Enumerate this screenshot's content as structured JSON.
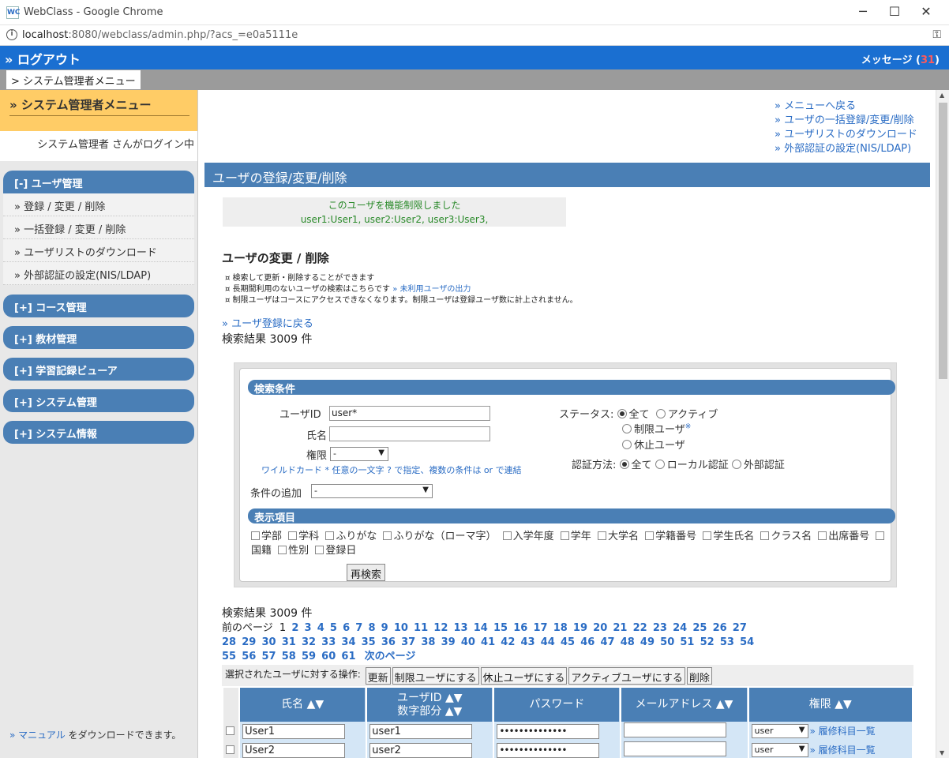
{
  "window": {
    "title": "WebClass - Google Chrome",
    "app_icon": "WC",
    "url_host": "localhost",
    "url_rest": ":8080/webclass/admin.php/?acs_=e0a5111e"
  },
  "header": {
    "logout": "» ログアウト",
    "message_label": "メッセージ (",
    "message_count": "31",
    "message_close": ")",
    "breadcrumb": "> システム管理者メニュー"
  },
  "sidebar": {
    "title": "» システム管理者メニュー",
    "login_text": "システム管理者 さんがログイン中",
    "groups": [
      {
        "label": "[-] ユーザ管理",
        "items": [
          "» 登録 / 変更 / 削除",
          "» 一括登録 / 変更 / 削除",
          "» ユーザリストのダウンロード",
          "» 外部認証の設定(NIS/LDAP)"
        ]
      },
      {
        "label": "[+] コース管理"
      },
      {
        "label": "[+] 教材管理"
      },
      {
        "label": "[+] 学習記録ビューア"
      },
      {
        "label": "[+] システム管理"
      },
      {
        "label": "[+] システム情報"
      }
    ],
    "footer_link": "» マニュアル",
    "footer_text": " をダウンロードできます。"
  },
  "quicklinks": [
    "» メニューへ戻る",
    "» ユーザの一括登録/変更/削除",
    "» ユーザリストのダウンロード",
    "» 外部認証の設定(NIS/LDAP)"
  ],
  "page_title": "ユーザの登録/変更/削除",
  "notice": {
    "line1": "このユーザを機能制限しました",
    "line2": "user1:User1, user2:User2, user3:User3,"
  },
  "section_title": "ユーザの変更 / 削除",
  "notes": {
    "n1": "¤ 検索して更新・削除することができます",
    "n2": "¤ 長期間利用のないユーザの検索はこちらです",
    "n2_link": " » 未利用ユーザの出力",
    "n3": "¤ 制限ユーザはコースにアクセスできなくなります。制限ユーザは登録ユーザ数に計上されません。"
  },
  "back_link": "» ユーザ登録に戻る",
  "result_count_text": "検索結果 3009 件",
  "search": {
    "heading": "検索条件",
    "userid_label": "ユーザID",
    "userid_value": "user*",
    "name_label": "氏名",
    "name_value": "",
    "role_label": "権限",
    "role_value": "-",
    "wildcard_hint": "ワイルドカード *   任意の一文字 ? で指定、複数の条件は or で連結",
    "add_condition_label": "条件の追加",
    "add_condition_value": "-",
    "status_label": "ステータス:",
    "status_all": "全て",
    "status_active": "アクティブ",
    "status_limited": "制限ユーザ",
    "status_limited_mark": "※",
    "status_suspended": "休止ユーザ",
    "auth_label": "認証方法:",
    "auth_all": "全て",
    "auth_local": "ローカル認証",
    "auth_external": "外部認証",
    "display_heading": "表示項目",
    "display_items": [
      "学部",
      "学科",
      "ふりがな",
      "ふりがな（ローマ字）",
      "入学年度",
      "学年",
      "大学名",
      "学籍番号",
      "学生氏名",
      "クラス名",
      "出席番号",
      "国籍",
      "性別",
      "登録日"
    ],
    "research_button": "再検索"
  },
  "pager": {
    "prev": "前のページ",
    "current": "1",
    "pages": [
      "2",
      "3",
      "4",
      "5",
      "6",
      "7",
      "8",
      "9",
      "10",
      "11",
      "12",
      "13",
      "14",
      "15",
      "16",
      "17",
      "18",
      "19",
      "20",
      "21",
      "22",
      "23",
      "24",
      "25",
      "26",
      "27",
      "28",
      "29",
      "30",
      "31",
      "32",
      "33",
      "34",
      "35",
      "36",
      "37",
      "38",
      "39",
      "40",
      "41",
      "42",
      "43",
      "44",
      "45",
      "46",
      "47",
      "48",
      "49",
      "50",
      "51",
      "52",
      "53",
      "54",
      "55",
      "56",
      "57",
      "58",
      "59",
      "60",
      "61"
    ],
    "next": "次のページ"
  },
  "ops": {
    "label": "選択されたユーザに対する操作:",
    "update": "更新",
    "limit": "制限ユーザにする",
    "suspend": "休止ユーザにする",
    "activate": "アクティブユーザにする",
    "delete": "削除"
  },
  "table": {
    "headers": [
      "氏名 ▲▼",
      "ユーザID ▲▼",
      "数字部分 ▲▼",
      "パスワード",
      "メールアドレス ▲▼",
      "権限 ▲▼"
    ],
    "rows": [
      {
        "name": "User1",
        "userid": "user1",
        "password": "••••••••••••••",
        "email": "",
        "role": "user",
        "courses": "» 履修科目一覧"
      },
      {
        "name": "User2",
        "userid": "user2",
        "password": "••••••••••••••",
        "email": "",
        "role": "user",
        "courses": "» 履修科目一覧"
      }
    ]
  }
}
